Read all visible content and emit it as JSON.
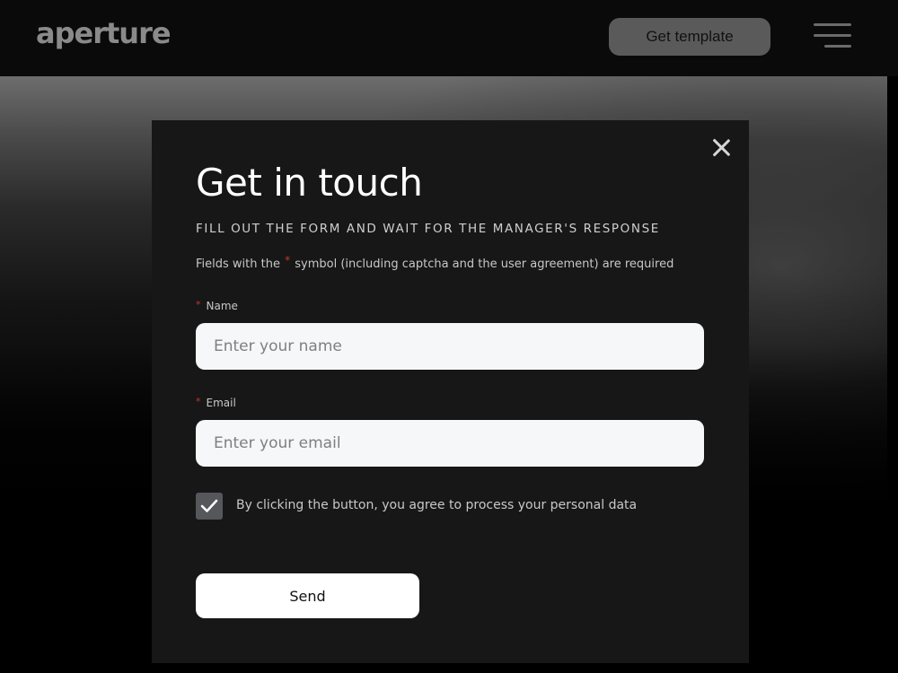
{
  "header": {
    "logo": "aperture",
    "get_template_label": "Get template",
    "menu_icon": "hamburger-menu-icon"
  },
  "modal": {
    "close_icon": "close-icon",
    "title": "Get in touch",
    "subtitle": "FILL OUT THE FORM AND WAIT FOR THE MANAGER'S RESPONSE",
    "required_note_prefix": "Fields with the",
    "required_note_suffix": "symbol (including captcha and the user agreement) are required",
    "asterisk": "*",
    "name_label": "Name",
    "name_placeholder": "Enter your name",
    "email_label": "Email",
    "email_placeholder": "Enter your email",
    "agreement_checked": true,
    "agreement_text": "By clicking the button, you agree to process your personal data",
    "send_label": "Send"
  },
  "colors": {
    "modal_bg": "#171717",
    "required_asterisk": "#c0392b",
    "input_bg": "#f6f7f9",
    "checkbox_bg": "#55575a"
  }
}
